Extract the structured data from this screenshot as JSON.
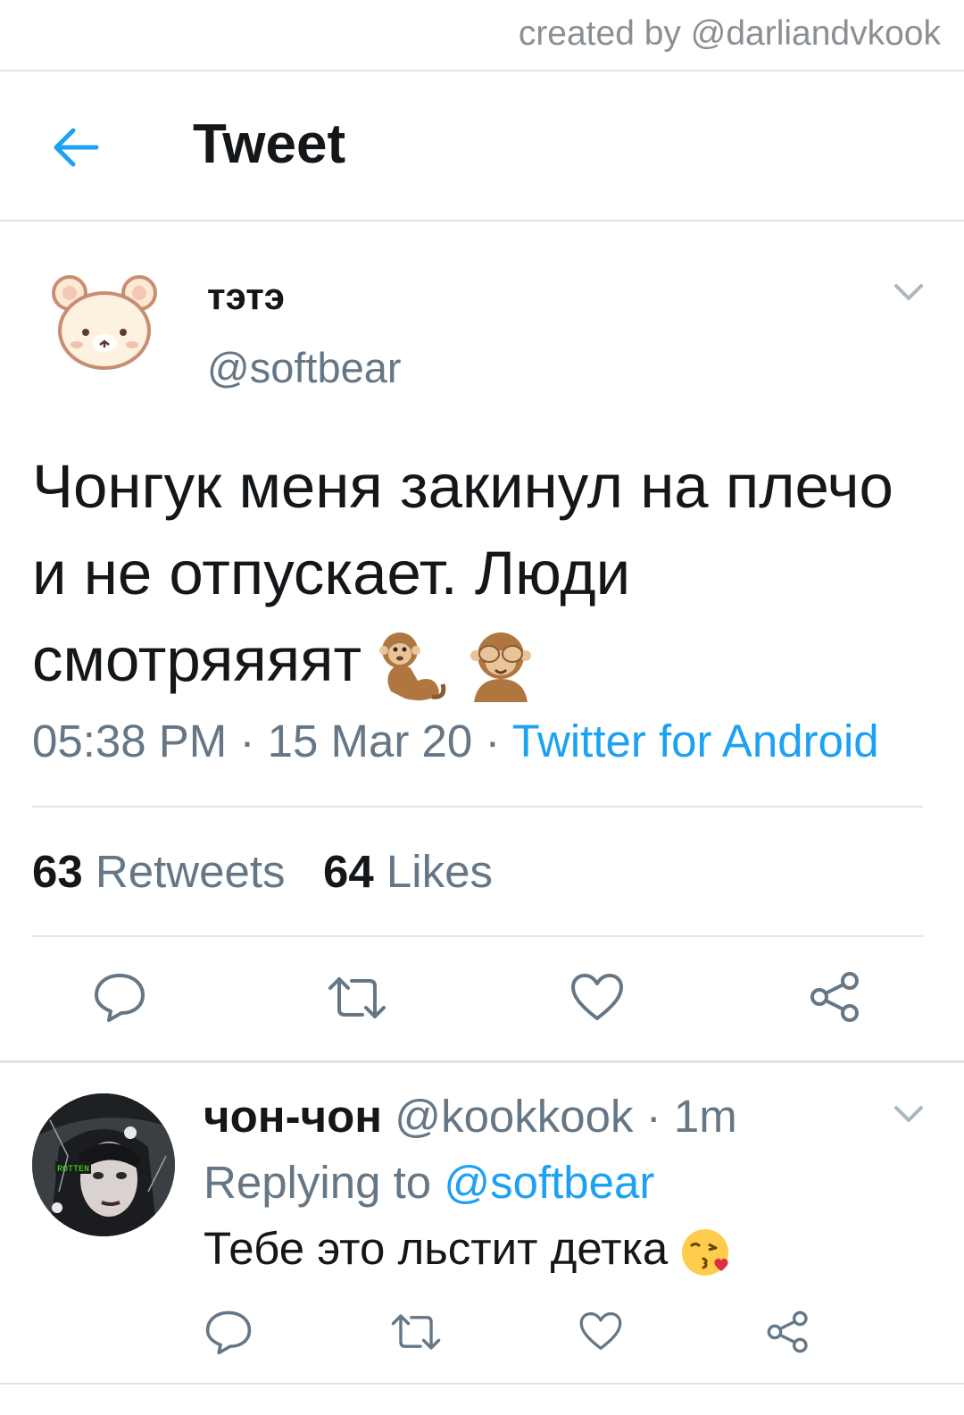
{
  "watermark": "created by @darliandvkook",
  "header": {
    "title": "Tweet",
    "back_icon": "arrow-left-icon"
  },
  "tweet": {
    "display_name": "тэтэ",
    "handle": "@softbear",
    "text": "Чонгук меня закинул на плечо и не отпускает. Люди смотряяяят",
    "emojis": [
      "monkey-emoji",
      "see-no-evil-monkey-emoji"
    ],
    "time": "05:38 PM",
    "date": "15 Mar 20",
    "separator": " · ",
    "source": "Twitter for Android",
    "retweets_count": "63",
    "retweets_label": "Retweets",
    "likes_count": "64",
    "likes_label": "Likes"
  },
  "reply": {
    "display_name": "чон-чон",
    "handle": "@kookkook",
    "age": "· 1m",
    "replying_to_label": "Replying to",
    "replying_to_handle": "@softbear",
    "text": "Тебе это льстит детка",
    "avatar_text": "ROTTEN",
    "emoji": "kissing-heart-emoji"
  },
  "colors": {
    "accent": "#1da1f2",
    "secondary_text": "#657786",
    "primary_text": "#14171a",
    "divider": "#e1e4e7"
  }
}
